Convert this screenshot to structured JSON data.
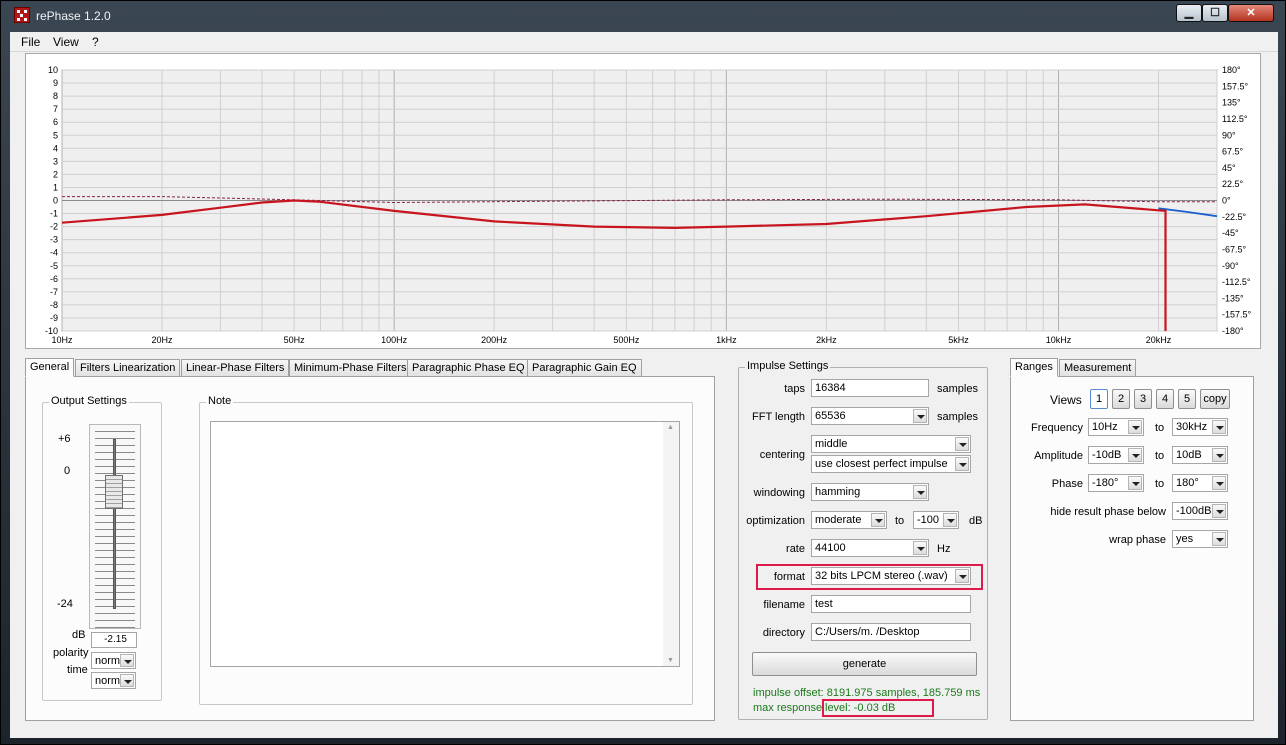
{
  "window": {
    "title": "rePhase 1.2.0",
    "min": "▁",
    "max": "☐",
    "close": "✕"
  },
  "menu": [
    "File",
    "View",
    "?"
  ],
  "graph": {
    "left_axis": [
      "10",
      "9",
      "8",
      "7",
      "6",
      "5",
      "4",
      "3",
      "2",
      "1",
      "0",
      "-1",
      "-2",
      "-3",
      "-4",
      "-5",
      "-6",
      "-7",
      "-8",
      "-9",
      "-10"
    ],
    "right_axis": [
      "180°",
      "157.5°",
      "135°",
      "112.5°",
      "90°",
      "67.5°",
      "45°",
      "22.5°",
      "0°",
      "-22.5°",
      "-45°",
      "-67.5°",
      "-90°",
      "-112.5°",
      "-135°",
      "-157.5°",
      "-180°"
    ],
    "freq_labels": [
      "10Hz",
      "20Hz",
      "50Hz",
      "100Hz",
      "200Hz",
      "500Hz",
      "1kHz",
      "2kHz",
      "5kHz",
      "10kHz",
      "20kHz"
    ],
    "colors": {
      "result": "#c8141e",
      "phase": "#1a5fd0",
      "target": "#8a2050"
    }
  },
  "chart_data": {
    "type": "line",
    "xscale": "log",
    "xlim": [
      10,
      30000
    ],
    "ylim": [
      -10,
      10
    ],
    "y2lim": [
      -180,
      180
    ],
    "series": [
      {
        "x": [
          10,
          20,
          30,
          40,
          50,
          60,
          100,
          200,
          400,
          700,
          1000,
          2000,
          4000,
          8000,
          12000,
          20000,
          21000,
          21000
        ],
        "values": [
          -1.7,
          -1.1,
          -0.55,
          -0.15,
          0,
          -0.1,
          -0.8,
          -1.6,
          -2.0,
          -2.1,
          -2.0,
          -1.8,
          -1.2,
          -0.5,
          -0.3,
          -0.75,
          -0.8,
          -10
        ]
      },
      {
        "x": [
          20000,
          24000,
          30000
        ],
        "values": [
          -0.6,
          -0.85,
          -1.2
        ]
      },
      {
        "x": [
          10,
          20,
          50,
          100,
          300,
          1000,
          3000,
          10000,
          20000,
          30000
        ],
        "values": [
          0.3,
          0.3,
          0.05,
          -0.15,
          -0.05,
          0.05,
          0.1,
          0.05,
          -0.1,
          -0.1
        ]
      }
    ]
  },
  "tabs": [
    "General",
    "Filters Linearization",
    "Linear-Phase Filters",
    "Minimum-Phase Filters",
    "Paragraphic Phase EQ",
    "Paragraphic Gain EQ"
  ],
  "output": {
    "title": "Output Settings",
    "scale_top": "+6",
    "scale_zero": "0",
    "scale_bottom": "-24",
    "db_label": "dB",
    "db_value": "-2.15",
    "polarity_label": "polarity",
    "polarity": "norm",
    "time_label": "time",
    "time": "norm"
  },
  "note": {
    "title": "Note",
    "up": "▲",
    "down": "▼"
  },
  "impulse": {
    "title": "Impulse Settings",
    "taps_label": "taps",
    "taps": "16384",
    "samples1": "samples",
    "fft_label": "FFT length",
    "fft": "65536",
    "samples2": "samples",
    "centering_label": "centering",
    "centering1": "middle",
    "centering2": "use closest perfect impulse",
    "windowing_label": "windowing",
    "windowing": "hamming",
    "optimization_label": "optimization",
    "optimization": "moderate",
    "to": "to",
    "opt_db": "-100",
    "db": "dB",
    "rate_label": "rate",
    "rate": "44100",
    "hz": "Hz",
    "format_label": "format",
    "format": "32 bits LPCM stereo (.wav)",
    "filename_label": "filename",
    "filename": "test",
    "directory_label": "directory",
    "directory": "C:/Users/m. /Desktop",
    "generate": "generate",
    "offset_line": "impulse offset: 8191.975 samples, 185.759 ms",
    "max_prefix": "max response",
    "max_level": "level: -0.03 dB"
  },
  "right_tabs": [
    "Ranges",
    "Measurement"
  ],
  "ranges": {
    "views_label": "Views",
    "views": [
      "1",
      "2",
      "3",
      "4",
      "5"
    ],
    "copy": "copy",
    "frequency_label": "Frequency",
    "freq_from": "10Hz",
    "freq_to": "30kHz",
    "amplitude_label": "Amplitude",
    "amp_from": "-10dB",
    "amp_to": "10dB",
    "phase_label": "Phase",
    "phase_from": "-180°",
    "phase_to": "180°",
    "to": "to",
    "hide_label": "hide result phase below",
    "hide_value": "-100dB",
    "wrap_label": "wrap phase",
    "wrap_value": "yes"
  }
}
